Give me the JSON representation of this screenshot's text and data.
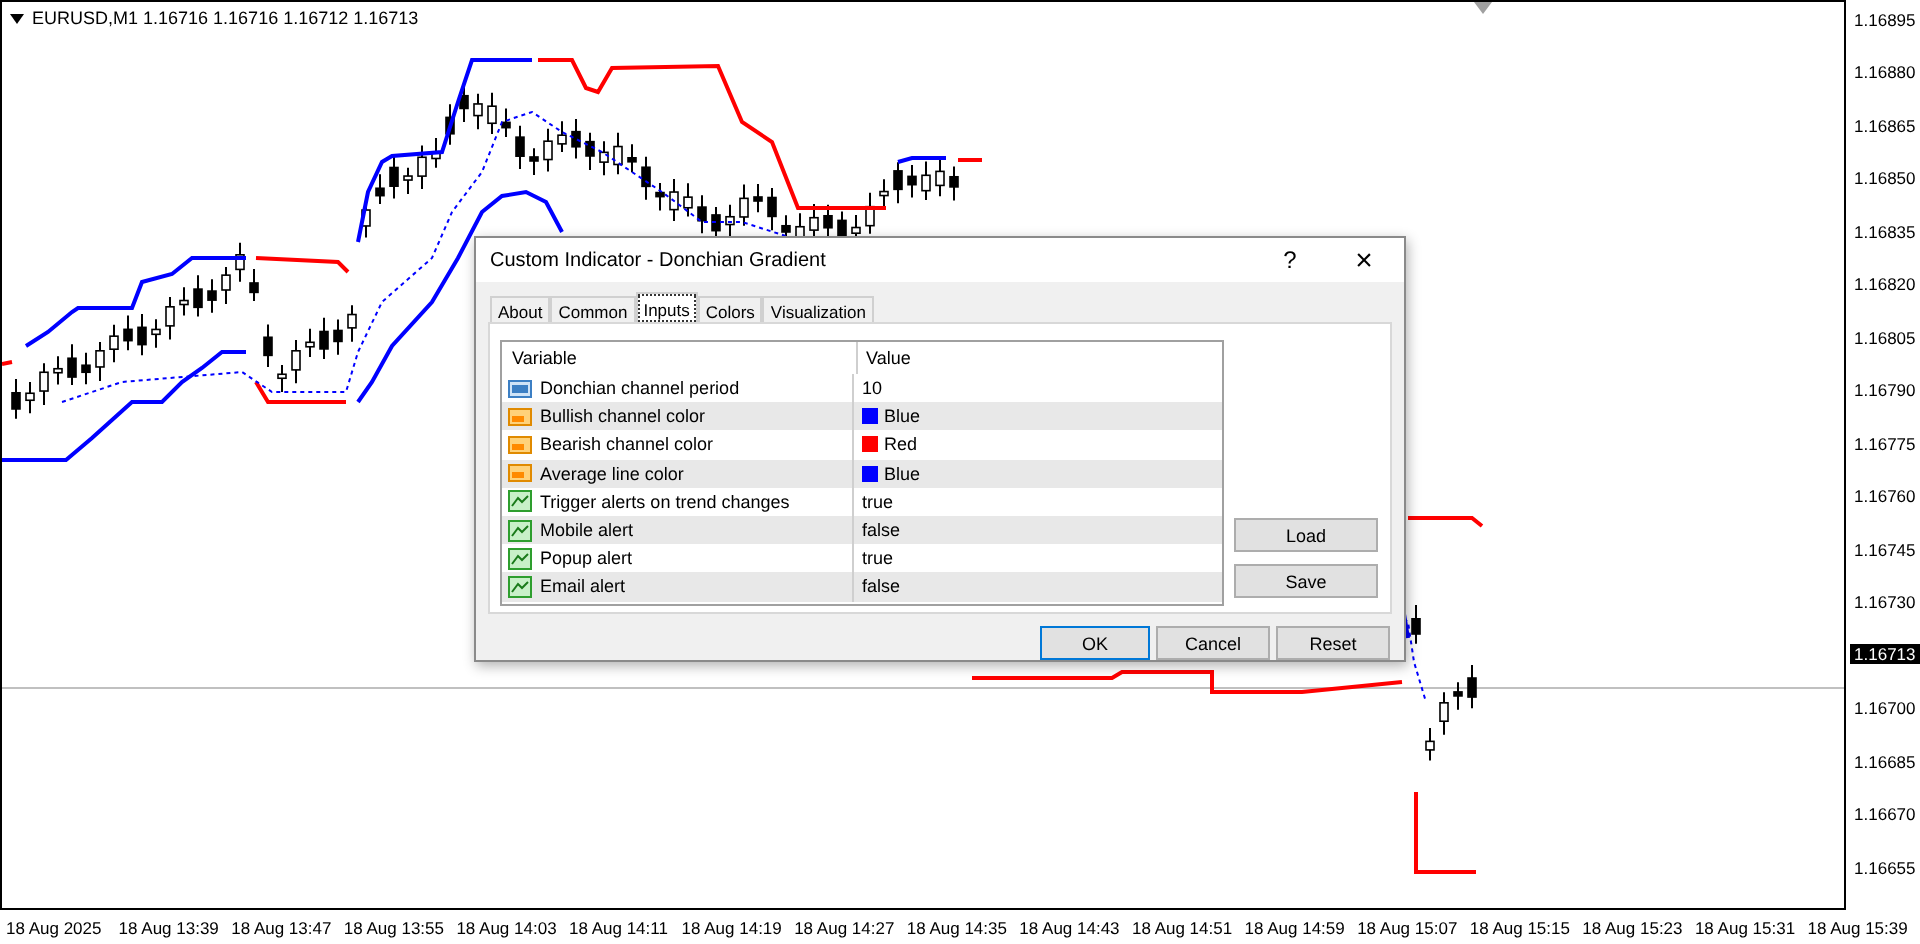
{
  "chart": {
    "symbol_line": "EURUSD,M1  1.16716 1.16716 1.16712 1.16713"
  },
  "price_axis": [
    {
      "label": "1.16895",
      "kind": "tick"
    },
    {
      "label": "1.16880",
      "kind": "tick"
    },
    {
      "label": "1.16865",
      "kind": "tick"
    },
    {
      "label": "1.16850",
      "kind": "tick"
    },
    {
      "label": "1.16835",
      "kind": "tick"
    },
    {
      "label": "1.16820",
      "kind": "tick"
    },
    {
      "label": "1.16805",
      "kind": "tick"
    },
    {
      "label": "1.16790",
      "kind": "tick"
    },
    {
      "label": "1.16775",
      "kind": "tick"
    },
    {
      "label": "1.16760",
      "kind": "tick"
    },
    {
      "label": "1.16745",
      "kind": "tick"
    },
    {
      "label": "1.16730",
      "kind": "tick"
    },
    {
      "label": "1.16713",
      "kind": "current"
    },
    {
      "label": "1.16700",
      "kind": "tick"
    },
    {
      "label": "1.16685",
      "kind": "tick"
    },
    {
      "label": "1.16670",
      "kind": "tick"
    },
    {
      "label": "1.16655",
      "kind": "tick"
    }
  ],
  "time_axis": [
    "18 Aug 2025",
    "18 Aug 13:39",
    "18 Aug 13:47",
    "18 Aug 13:55",
    "18 Aug 14:03",
    "18 Aug 14:11",
    "18 Aug 14:19",
    "18 Aug 14:27",
    "18 Aug 14:35",
    "18 Aug 14:43",
    "18 Aug 14:51",
    "18 Aug 14:59",
    "18 Aug 15:07",
    "18 Aug 15:15",
    "18 Aug 15:23",
    "18 Aug 15:31",
    "18 Aug 15:39"
  ],
  "dialog": {
    "title": "Custom Indicator - Donchian Gradient",
    "help": "?",
    "close": "×",
    "tabs": [
      {
        "label": "About",
        "selected": false
      },
      {
        "label": "Common",
        "selected": false
      },
      {
        "label": "Inputs",
        "selected": true
      },
      {
        "label": "Colors",
        "selected": false
      },
      {
        "label": "Visualization",
        "selected": false
      }
    ],
    "columns": [
      "Variable",
      "Value"
    ],
    "rows": [
      {
        "variable": "Donchian channel period",
        "value": "10",
        "kind": "number"
      },
      {
        "variable": "Bullish channel color",
        "value": "Blue",
        "kind": "color",
        "color": "#0000ff"
      },
      {
        "variable": "Bearish channel color",
        "value": "Red",
        "kind": "color",
        "color": "#ff0000"
      },
      {
        "variable": "Average line color",
        "value": "Blue",
        "kind": "color",
        "color": "#0000ff"
      },
      {
        "variable": "Trigger alerts on trend changes",
        "value": "true",
        "kind": "bool"
      },
      {
        "variable": "Mobile alert",
        "value": "false",
        "kind": "bool"
      },
      {
        "variable": "Popup alert",
        "value": "true",
        "kind": "bool"
      },
      {
        "variable": "Email alert",
        "value": "false",
        "kind": "bool"
      }
    ],
    "side_buttons": [
      "Load",
      "Save"
    ],
    "buttons": [
      {
        "label": "OK",
        "default": true
      },
      {
        "label": "Cancel",
        "default": false
      },
      {
        "label": "Reset",
        "default": false
      }
    ]
  }
}
